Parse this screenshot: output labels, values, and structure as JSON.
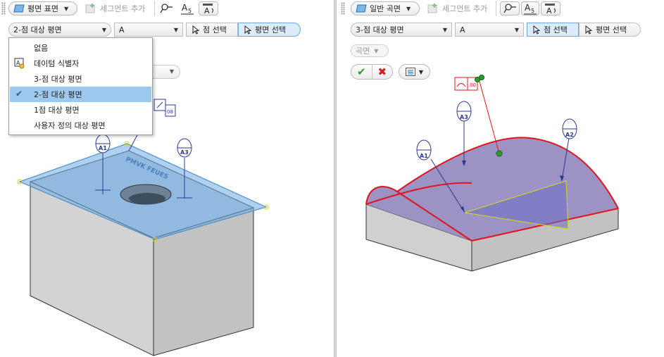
{
  "left": {
    "toolbar": {
      "surface_dropdown": "평면 표면",
      "add_segment": "세그먼트 추가"
    },
    "row2": {
      "target_plane": "2-점 대상 평면",
      "datum_letter": "A",
      "point_select": "점 선택",
      "plane_select": "평면 선택"
    },
    "dropdown": {
      "items": [
        {
          "label": "없음",
          "icon": "none",
          "selected": false
        },
        {
          "label": "데이텀 식별자",
          "icon": "datum-identifier-icon",
          "selected": false
        },
        {
          "label": "3-점 대상 평면",
          "icon": "none",
          "selected": false
        },
        {
          "label": "2-점 대상 평면",
          "icon": "check-icon",
          "selected": true
        },
        {
          "label": "1점 대상 평면",
          "icon": "none",
          "selected": false
        },
        {
          "label": "사용자 정의 대상 평면",
          "icon": "none",
          "selected": false
        }
      ]
    },
    "scene": {
      "labels": [
        "A1",
        "A3"
      ],
      "top_text": "PMVK FEUES"
    }
  },
  "right": {
    "toolbar": {
      "surface_dropdown": "일반 곡면",
      "add_segment": "세그먼트 추가"
    },
    "row2": {
      "target_plane": "3-점 대상 평면",
      "datum_letter": "A",
      "point_select": "점 선택",
      "plane_select": "평면 선택"
    },
    "surface_combo": "곡면",
    "scene": {
      "labels": [
        "A1",
        "A3",
        "A2"
      ]
    }
  },
  "colors": {
    "accent_blue": "#9dc9ef",
    "annotation_blue": "#2b3a8f",
    "highlight_red": "#e0141c",
    "ok_green": "#2aa02a",
    "cancel_red": "#d62020"
  }
}
